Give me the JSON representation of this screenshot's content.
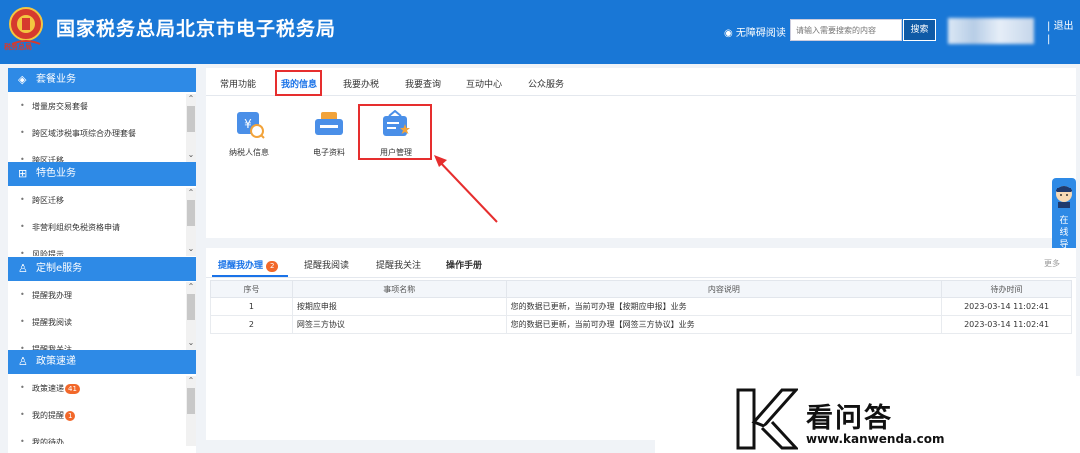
{
  "header": {
    "emblem_text": "税务总局",
    "title": "国家税务总局北京市电子税务局",
    "accessibility": "无障碍阅读",
    "search_placeholder": "请输入需要搜索的内容",
    "search_button": "搜索",
    "logout": "退出",
    "colors": {
      "header_bg": "#1977d6",
      "accent": "#2e8ae6",
      "highlight_red": "#e62e2e",
      "badge": "#f2682a"
    }
  },
  "sidebar": {
    "sections": [
      {
        "title": "套餐业务",
        "icon": "layers-icon",
        "items": [
          "增量房交易套餐",
          "跨区域涉税事项综合办理套餐",
          "跨区迁移"
        ]
      },
      {
        "title": "特色业务",
        "icon": "grid-icon",
        "items": [
          "跨区迁移",
          "非营利组织免税资格申请",
          "风险提示"
        ]
      },
      {
        "title": "定制e服务",
        "icon": "user-icon",
        "items": [
          "提醒我办理",
          "提醒我阅读",
          "提醒我关注"
        ]
      },
      {
        "title": "政策速递",
        "icon": "user-icon",
        "items": [
          "政策速递",
          "我的提醒",
          "我的待办"
        ],
        "badges": [
          "41",
          "1"
        ]
      }
    ]
  },
  "top_panel": {
    "tabs": [
      "常用功能",
      "我的信息",
      "我要办税",
      "我要查询",
      "互动中心",
      "公众服务"
    ],
    "active_tab": "我的信息",
    "apps": [
      {
        "label": "纳税人信息",
        "icon": "taxpayer-info-icon"
      },
      {
        "label": "电子资料",
        "icon": "electronic-docs-icon"
      },
      {
        "label": "用户管理",
        "icon": "user-management-icon"
      }
    ]
  },
  "float_guide": {
    "label": "在线导办"
  },
  "bottom_panel": {
    "tabs": [
      "提醒我办理",
      "提醒我阅读",
      "提醒我关注",
      "操作手册"
    ],
    "active_tab_badge": "2",
    "more": "更多",
    "columns": [
      "序号",
      "事项名称",
      "内容说明",
      "待办时间"
    ],
    "rows": [
      {
        "no": "1",
        "name": "按期应申报",
        "desc": "您的数据已更新，当前可办理【按期应申报】业务",
        "time": "2023-03-14 11:02:41"
      },
      {
        "no": "2",
        "name": "网签三方协议",
        "desc": "您的数据已更新，当前可办理【网签三方协议】业务",
        "time": "2023-03-14 11:02:41"
      }
    ]
  },
  "watermark": {
    "brand": "看问答",
    "url": "www.kanwenda.com"
  }
}
